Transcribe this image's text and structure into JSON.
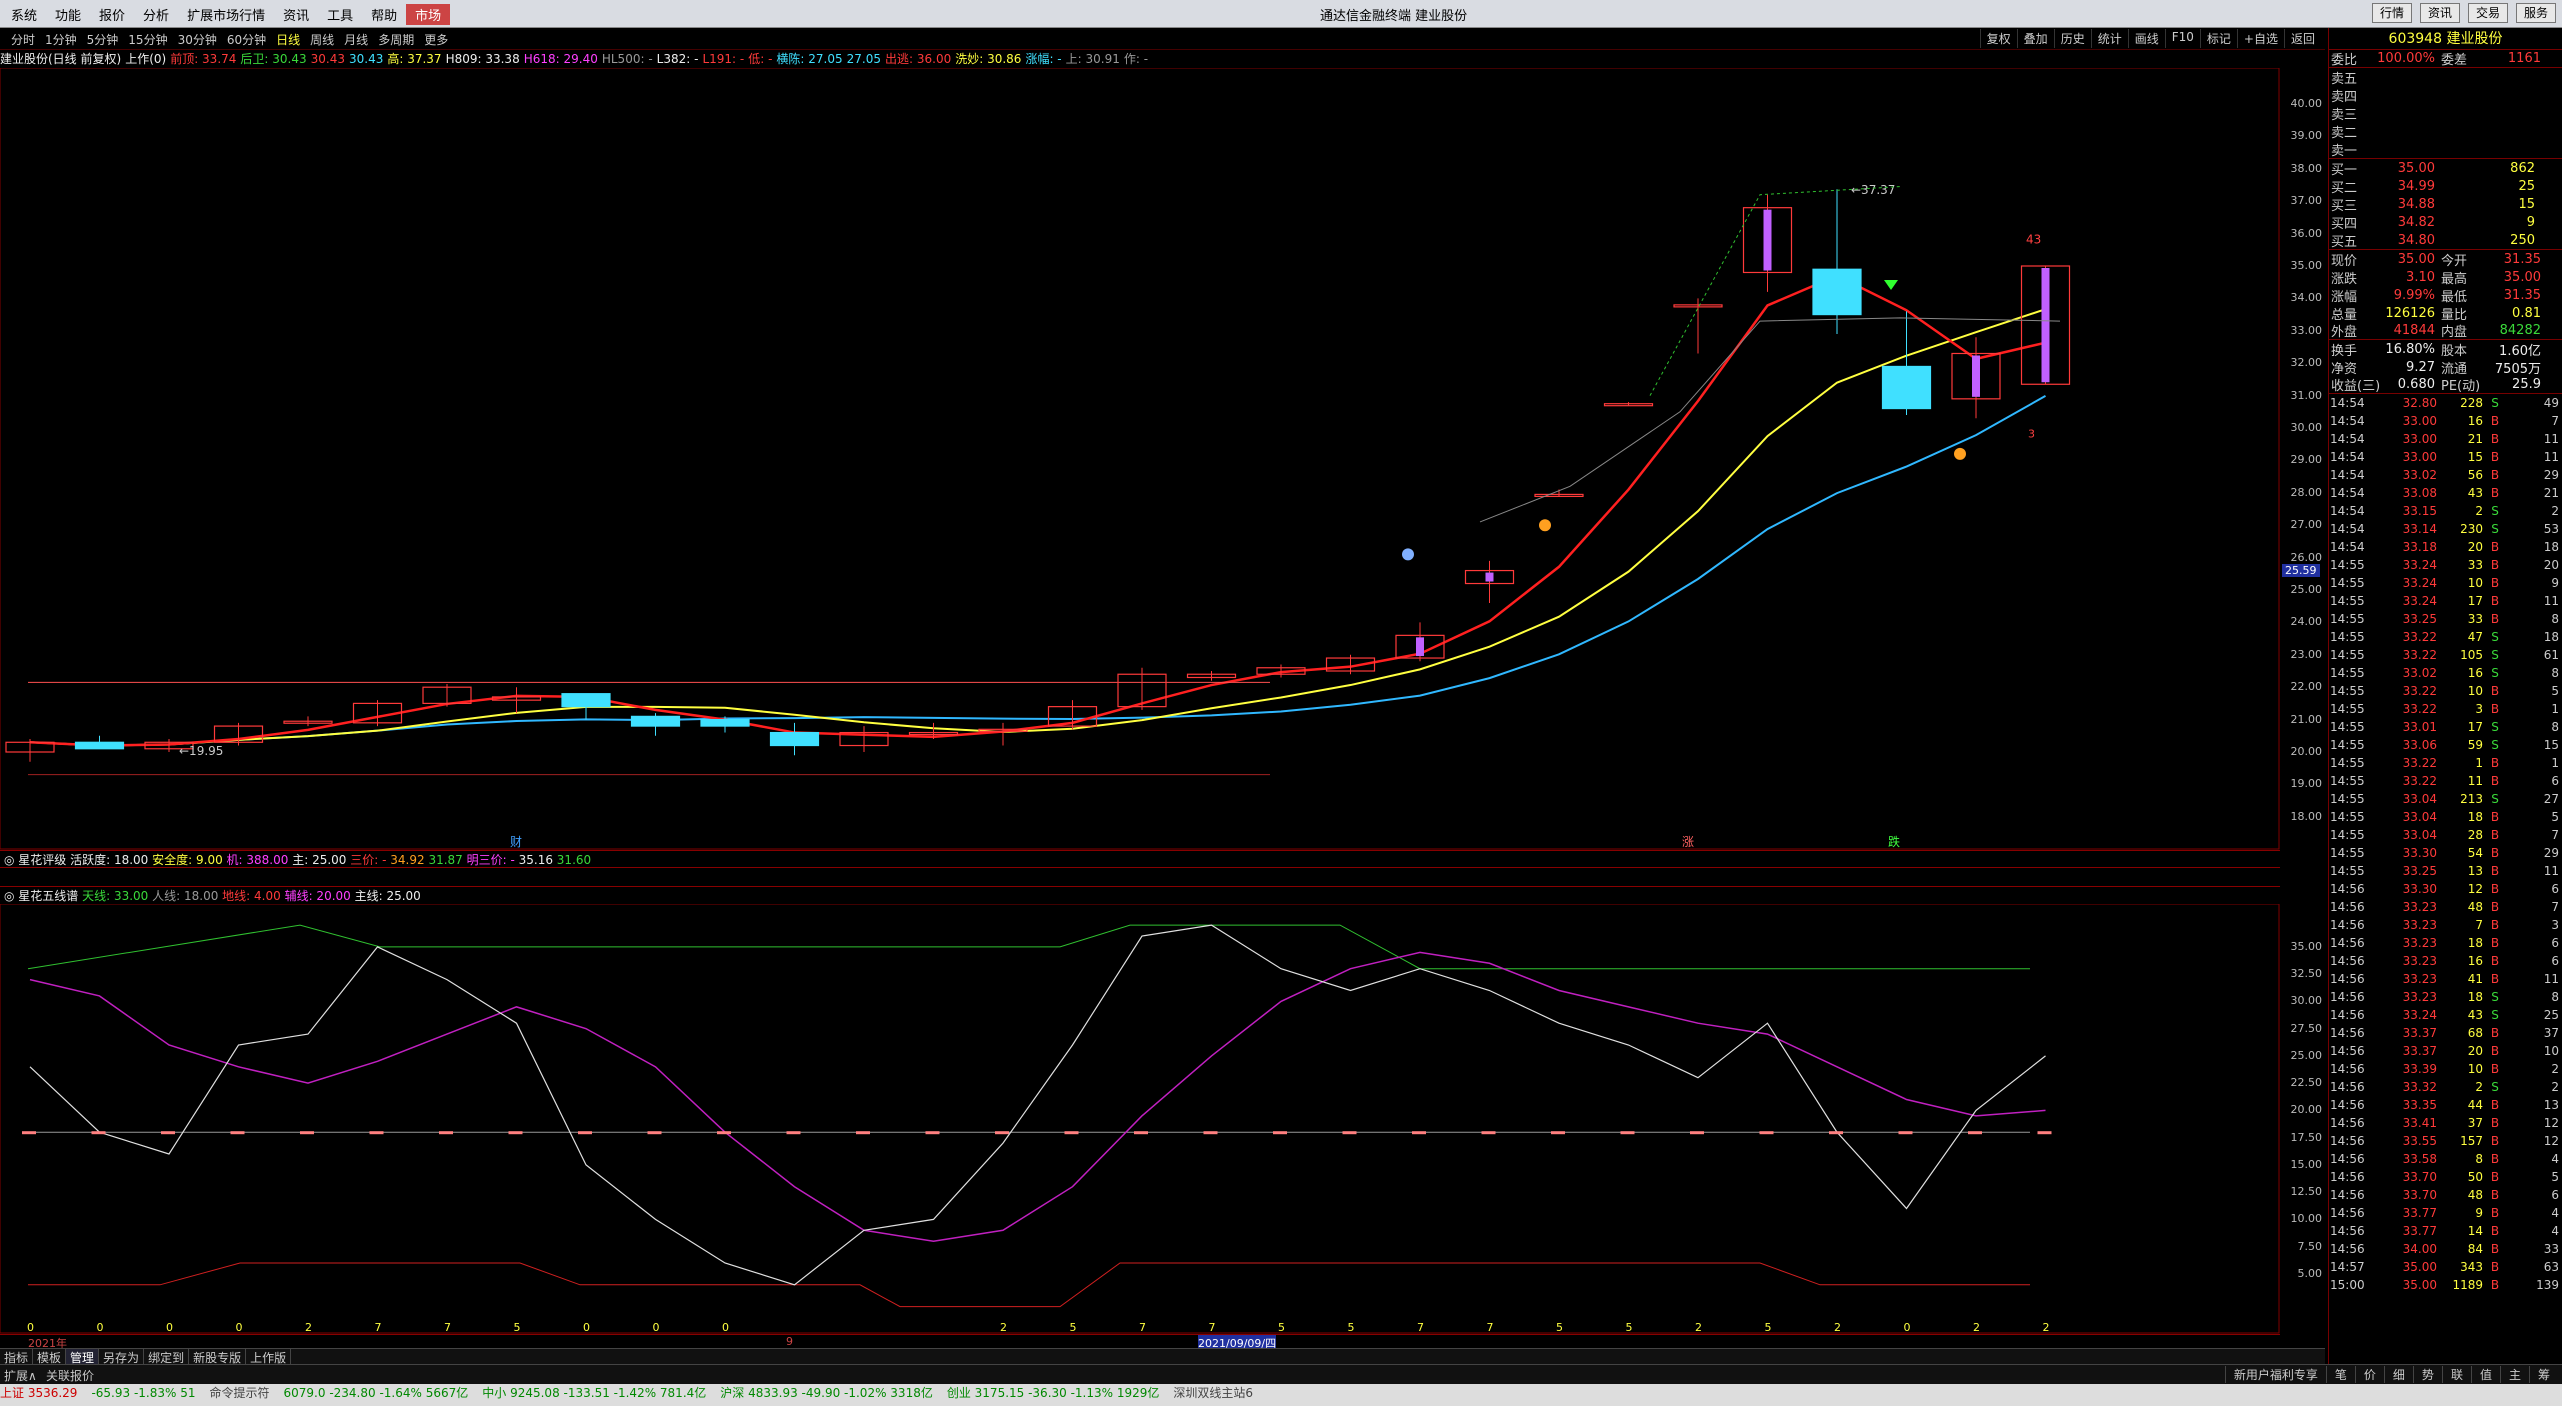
{
  "app": {
    "title": "通达信金融终端 建业股份",
    "menu": [
      "系统",
      "功能",
      "报价",
      "分析",
      "扩展市场行情",
      "资讯",
      "工具",
      "帮助",
      "市场"
    ],
    "active_menu": "市场",
    "right_buttons": [
      "行情",
      "资讯",
      "交易",
      "服务"
    ]
  },
  "periods": [
    "分时",
    "1分钟",
    "5分钟",
    "15分钟",
    "30分钟",
    "60分钟",
    "日线",
    "周线",
    "月线",
    "多周期",
    "更多"
  ],
  "active_period": "日线",
  "tools": [
    "复权",
    "叠加",
    "历史",
    "统计",
    "画线",
    "F10",
    "标记",
    "+自选",
    "返回"
  ],
  "info_line": [
    {
      "t": "建业股份(日线 前复权)",
      "c": "white"
    },
    {
      "t": "上作(0)",
      "c": "white"
    },
    {
      "t": "前顶: 33.74",
      "c": "red"
    },
    {
      "t": "后卫: 30.43",
      "c": "green"
    },
    {
      "t": "30.43",
      "c": "red"
    },
    {
      "t": "30.43",
      "c": "cyan"
    },
    {
      "t": "高: 37.37",
      "c": "yellow"
    },
    {
      "t": "H809: 33.38",
      "c": "white"
    },
    {
      "t": "H618: 29.40",
      "c": "magenta"
    },
    {
      "t": "HL500: -",
      "c": "gray"
    },
    {
      "t": "L382: -",
      "c": "white"
    },
    {
      "t": "L191: -",
      "c": "red"
    },
    {
      "t": "低: -",
      "c": "red"
    },
    {
      "t": "横陈: 27.05",
      "c": "cyan"
    },
    {
      "t": "27.05",
      "c": "cyan"
    },
    {
      "t": "出逃: 36.00",
      "c": "red"
    },
    {
      "t": "洗妙: 30.86",
      "c": "yellow"
    },
    {
      "t": "涨幅: -",
      "c": "cyan"
    },
    {
      "t": "上: 30.91",
      "c": "gray"
    },
    {
      "t": "作: -",
      "c": "gray"
    }
  ],
  "indicator1": {
    "name": "星花评级",
    "items": [
      {
        "t": "活跃度: 18.00",
        "c": "white"
      },
      {
        "t": "安全度: 9.00",
        "c": "yellow"
      },
      {
        "t": "机: 388.00",
        "c": "magenta"
      },
      {
        "t": "主: 25.00",
        "c": "white"
      },
      {
        "t": "三价: -",
        "c": "red"
      },
      {
        "t": "34.92",
        "c": "orange"
      },
      {
        "t": "31.87",
        "c": "green"
      },
      {
        "t": "明三价: -",
        "c": "magenta"
      },
      {
        "t": "35.16",
        "c": "white"
      },
      {
        "t": "31.60",
        "c": "green"
      }
    ]
  },
  "indicator2": {
    "name": "星花五线谱",
    "items": [
      {
        "t": "天线: 33.00",
        "c": "green"
      },
      {
        "t": "人线: 18.00",
        "c": "gray"
      },
      {
        "t": "地线: 4.00",
        "c": "red"
      },
      {
        "t": "辅线: 20.00",
        "c": "magenta"
      },
      {
        "t": "主线: 25.00",
        "c": "white"
      }
    ]
  },
  "main_axis": [
    "40.00",
    "39.00",
    "38.00",
    "37.00",
    "36.00",
    "35.00",
    "34.00",
    "33.00",
    "32.00",
    "31.00",
    "30.00",
    "29.00",
    "28.00",
    "27.00",
    "26.00",
    "25.00",
    "24.00",
    "23.00",
    "22.00",
    "21.00",
    "20.00",
    "19.00",
    "18.00"
  ],
  "current_price_tag": "25.59",
  "sub_axis": [
    "35.00",
    "32.50",
    "30.00",
    "27.50",
    "25.00",
    "22.50",
    "20.00",
    "17.50",
    "15.00",
    "12.50",
    "10.00",
    "7.50",
    "5.00"
  ],
  "chart_annotations": {
    "high": "37.37",
    "low": "19.95",
    "top_num": "43",
    "side_num": "3",
    "markers": [
      "财",
      "涨",
      "跌"
    ]
  },
  "x_labels": [
    "2021年",
    "9",
    "2021/09/09/四"
  ],
  "x_digits": [
    "0",
    "0",
    "0",
    "0",
    "2",
    "7",
    "7",
    "5",
    "0",
    "0",
    "0",
    "",
    "",
    "",
    "2",
    "5",
    "7",
    "7",
    "5",
    "5",
    "7",
    "7",
    "5",
    "5",
    "2",
    "5",
    "2",
    "0",
    "2",
    "2"
  ],
  "bottom_tabs": [
    "指标",
    "模板",
    "管理",
    "另存为",
    "绑定到",
    "新股专版",
    "上作版"
  ],
  "active_tab": "管理",
  "bottom2": {
    "left": "扩展∧",
    "mid": "关联报价",
    "right_items": [
      "新用户福利专享",
      "笔",
      "价",
      "细",
      "势",
      "联",
      "值",
      "主",
      "筹"
    ]
  },
  "statusbar": [
    {
      "t": "上证 3536.29",
      "c": "red"
    },
    {
      "t": "-65.93 -1.83% 51",
      "c": "green"
    },
    {
      "t": "命令提示符",
      "c": "gray"
    },
    {
      "t": "6079.0 -234.80 -1.64% 5667亿",
      "c": "green"
    },
    {
      "t": "中小 9245.08 -133.51 -1.42% 781.4亿",
      "c": "green"
    },
    {
      "t": "沪深 4833.93 -49.90 -1.02% 3318亿",
      "c": "green"
    },
    {
      "t": "创业 3175.15 -36.30 -1.13% 1929亿",
      "c": "green"
    },
    {
      "t": "深圳双线主站6",
      "c": "gray"
    }
  ],
  "quote": {
    "code_name": "603948 建业股份",
    "weibi": {
      "label": "委比",
      "val": "100.00%",
      "lab2": "委差",
      "val2": "1161"
    },
    "sells": [
      {
        "lab": "卖五",
        "p": "",
        "v": ""
      },
      {
        "lab": "卖四",
        "p": "",
        "v": ""
      },
      {
        "lab": "卖三",
        "p": "",
        "v": ""
      },
      {
        "lab": "卖二",
        "p": "",
        "v": ""
      },
      {
        "lab": "卖一",
        "p": "",
        "v": ""
      }
    ],
    "buys": [
      {
        "lab": "买一",
        "p": "35.00",
        "v": "862"
      },
      {
        "lab": "买二",
        "p": "34.99",
        "v": "25"
      },
      {
        "lab": "买三",
        "p": "34.88",
        "v": "15"
      },
      {
        "lab": "买四",
        "p": "34.82",
        "v": "9"
      },
      {
        "lab": "买五",
        "p": "34.80",
        "v": "250"
      }
    ],
    "stats": [
      {
        "l1": "现价",
        "v1": "35.00",
        "c1": "red",
        "l2": "今开",
        "v2": "31.35",
        "c2": "red"
      },
      {
        "l1": "涨跌",
        "v1": "3.10",
        "c1": "red",
        "l2": "最高",
        "v2": "35.00",
        "c2": "red"
      },
      {
        "l1": "涨幅",
        "v1": "9.99%",
        "c1": "red",
        "l2": "最低",
        "v2": "31.35",
        "c2": "red"
      },
      {
        "l1": "总量",
        "v1": "126126",
        "c1": "yellow",
        "l2": "量比",
        "v2": "0.81",
        "c2": "yellow"
      },
      {
        "l1": "外盘",
        "v1": "41844",
        "c1": "red",
        "l2": "内盘",
        "v2": "84282",
        "c2": "green"
      },
      {
        "l1": "换手",
        "v1": "16.80%",
        "c1": "white",
        "l2": "股本",
        "v2": "1.60亿",
        "c2": "white"
      },
      {
        "l1": "净资",
        "v1": "9.27",
        "c1": "white",
        "l2": "流通",
        "v2": "7505万",
        "c2": "white"
      },
      {
        "l1": "收益(三)",
        "v1": "0.680",
        "c1": "white",
        "l2": "PE(动)",
        "v2": "25.9",
        "c2": "white"
      }
    ],
    "ticks": [
      [
        "14:54",
        "32.80",
        "228",
        "S",
        "49"
      ],
      [
        "14:54",
        "33.00",
        "16",
        "B",
        "7"
      ],
      [
        "14:54",
        "33.00",
        "21",
        "B",
        "11"
      ],
      [
        "14:54",
        "33.00",
        "15",
        "B",
        "11"
      ],
      [
        "14:54",
        "33.02",
        "56",
        "B",
        "29"
      ],
      [
        "14:54",
        "33.08",
        "43",
        "B",
        "21"
      ],
      [
        "14:54",
        "33.15",
        "2",
        "S",
        "2"
      ],
      [
        "14:54",
        "33.14",
        "230",
        "S",
        "53"
      ],
      [
        "14:54",
        "33.18",
        "20",
        "B",
        "18"
      ],
      [
        "14:55",
        "33.24",
        "33",
        "B",
        "20"
      ],
      [
        "14:55",
        "33.24",
        "10",
        "B",
        "9"
      ],
      [
        "14:55",
        "33.24",
        "17",
        "B",
        "11"
      ],
      [
        "14:55",
        "33.25",
        "33",
        "B",
        "8"
      ],
      [
        "14:55",
        "33.22",
        "47",
        "S",
        "18"
      ],
      [
        "14:55",
        "33.22",
        "105",
        "S",
        "61"
      ],
      [
        "14:55",
        "33.02",
        "16",
        "S",
        "8"
      ],
      [
        "14:55",
        "33.22",
        "10",
        "B",
        "5"
      ],
      [
        "14:55",
        "33.22",
        "3",
        "B",
        "1"
      ],
      [
        "14:55",
        "33.01",
        "17",
        "S",
        "8"
      ],
      [
        "14:55",
        "33.06",
        "59",
        "S",
        "15"
      ],
      [
        "14:55",
        "33.22",
        "1",
        "B",
        "1"
      ],
      [
        "14:55",
        "33.22",
        "11",
        "B",
        "6"
      ],
      [
        "14:55",
        "33.04",
        "213",
        "S",
        "27"
      ],
      [
        "14:55",
        "33.04",
        "18",
        "B",
        "5"
      ],
      [
        "14:55",
        "33.04",
        "28",
        "B",
        "7"
      ],
      [
        "14:55",
        "33.30",
        "54",
        "B",
        "29"
      ],
      [
        "14:55",
        "33.25",
        "13",
        "B",
        "11"
      ],
      [
        "14:56",
        "33.30",
        "12",
        "B",
        "6"
      ],
      [
        "14:56",
        "33.23",
        "48",
        "B",
        "7"
      ],
      [
        "14:56",
        "33.23",
        "7",
        "B",
        "3"
      ],
      [
        "14:56",
        "33.23",
        "18",
        "B",
        "6"
      ],
      [
        "14:56",
        "33.23",
        "16",
        "B",
        "6"
      ],
      [
        "14:56",
        "33.23",
        "41",
        "B",
        "11"
      ],
      [
        "14:56",
        "33.23",
        "18",
        "S",
        "8"
      ],
      [
        "14:56",
        "33.24",
        "43",
        "S",
        "25"
      ],
      [
        "14:56",
        "33.37",
        "68",
        "B",
        "37"
      ],
      [
        "14:56",
        "33.37",
        "20",
        "B",
        "10"
      ],
      [
        "14:56",
        "33.39",
        "10",
        "B",
        "2"
      ],
      [
        "14:56",
        "33.32",
        "2",
        "S",
        "2"
      ],
      [
        "14:56",
        "33.35",
        "44",
        "B",
        "13"
      ],
      [
        "14:56",
        "33.41",
        "37",
        "B",
        "12"
      ],
      [
        "14:56",
        "33.55",
        "157",
        "B",
        "12"
      ],
      [
        "14:56",
        "33.58",
        "8",
        "B",
        "4"
      ],
      [
        "14:56",
        "33.70",
        "50",
        "B",
        "5"
      ],
      [
        "14:56",
        "33.70",
        "48",
        "B",
        "6"
      ],
      [
        "14:56",
        "33.77",
        "9",
        "B",
        "4"
      ],
      [
        "14:56",
        "33.77",
        "14",
        "B",
        "4"
      ],
      [
        "14:56",
        "34.00",
        "84",
        "B",
        "33"
      ],
      [
        "14:57",
        "35.00",
        "343",
        "B",
        "63"
      ],
      [
        "15:00",
        "35.00",
        "1189",
        "B",
        "139"
      ]
    ]
  },
  "colors": {
    "up": "#ff3a3a",
    "down": "#40e0ff",
    "ma_red": "#ff2020",
    "ma_yellow": "#ffff40",
    "ma_blue": "#30b8ff",
    "grid_red": "#800000"
  },
  "candles": [
    {
      "o": 20.0,
      "h": 20.4,
      "l": 19.7,
      "c": 20.3
    },
    {
      "o": 20.3,
      "h": 20.5,
      "l": 20.1,
      "c": 20.1
    },
    {
      "o": 20.1,
      "h": 20.4,
      "l": 20.0,
      "c": 20.3
    },
    {
      "o": 20.3,
      "h": 20.9,
      "l": 20.2,
      "c": 20.8
    },
    {
      "o": 20.9,
      "h": 21.1,
      "l": 20.8,
      "c": 20.95
    },
    {
      "o": 20.9,
      "h": 21.6,
      "l": 20.8,
      "c": 21.5
    },
    {
      "o": 21.5,
      "h": 22.1,
      "l": 21.4,
      "c": 22.0
    },
    {
      "o": 21.6,
      "h": 22.0,
      "l": 21.2,
      "c": 21.7
    },
    {
      "o": 21.8,
      "h": 21.8,
      "l": 21.0,
      "c": 21.4
    },
    {
      "o": 21.1,
      "h": 21.2,
      "l": 20.5,
      "c": 20.8
    },
    {
      "o": 21.0,
      "h": 21.1,
      "l": 20.6,
      "c": 20.8
    },
    {
      "o": 20.6,
      "h": 20.9,
      "l": 19.9,
      "c": 20.2
    },
    {
      "o": 20.2,
      "h": 20.8,
      "l": 20.0,
      "c": 20.6
    },
    {
      "o": 20.6,
      "h": 20.9,
      "l": 20.4,
      "c": 20.6
    },
    {
      "o": 20.7,
      "h": 20.9,
      "l": 20.2,
      "c": 20.7
    },
    {
      "o": 20.8,
      "h": 21.6,
      "l": 20.7,
      "c": 21.4
    },
    {
      "o": 21.4,
      "h": 22.6,
      "l": 21.3,
      "c": 22.4
    },
    {
      "o": 22.3,
      "h": 22.5,
      "l": 22.2,
      "c": 22.4
    },
    {
      "o": 22.4,
      "h": 22.7,
      "l": 22.3,
      "c": 22.6
    },
    {
      "o": 22.5,
      "h": 23.0,
      "l": 22.4,
      "c": 22.9
    },
    {
      "o": 22.9,
      "h": 24.0,
      "l": 22.8,
      "c": 23.6
    },
    {
      "o": 25.2,
      "h": 25.9,
      "l": 24.6,
      "c": 25.6
    },
    {
      "o": 27.9,
      "h": 28.1,
      "l": 27.9,
      "c": 27.95
    },
    {
      "o": 30.7,
      "h": 30.8,
      "l": 30.7,
      "c": 30.75
    },
    {
      "o": 33.8,
      "h": 34.0,
      "l": 32.3,
      "c": 33.8
    },
    {
      "o": 34.8,
      "h": 37.2,
      "l": 34.2,
      "c": 36.8
    },
    {
      "o": 34.9,
      "h": 37.37,
      "l": 32.9,
      "c": 33.5
    },
    {
      "o": 31.9,
      "h": 33.6,
      "l": 30.4,
      "c": 30.6
    },
    {
      "o": 30.9,
      "h": 32.8,
      "l": 30.3,
      "c": 32.3
    },
    {
      "o": 31.35,
      "h": 35.0,
      "l": 31.35,
      "c": 35.0
    }
  ]
}
